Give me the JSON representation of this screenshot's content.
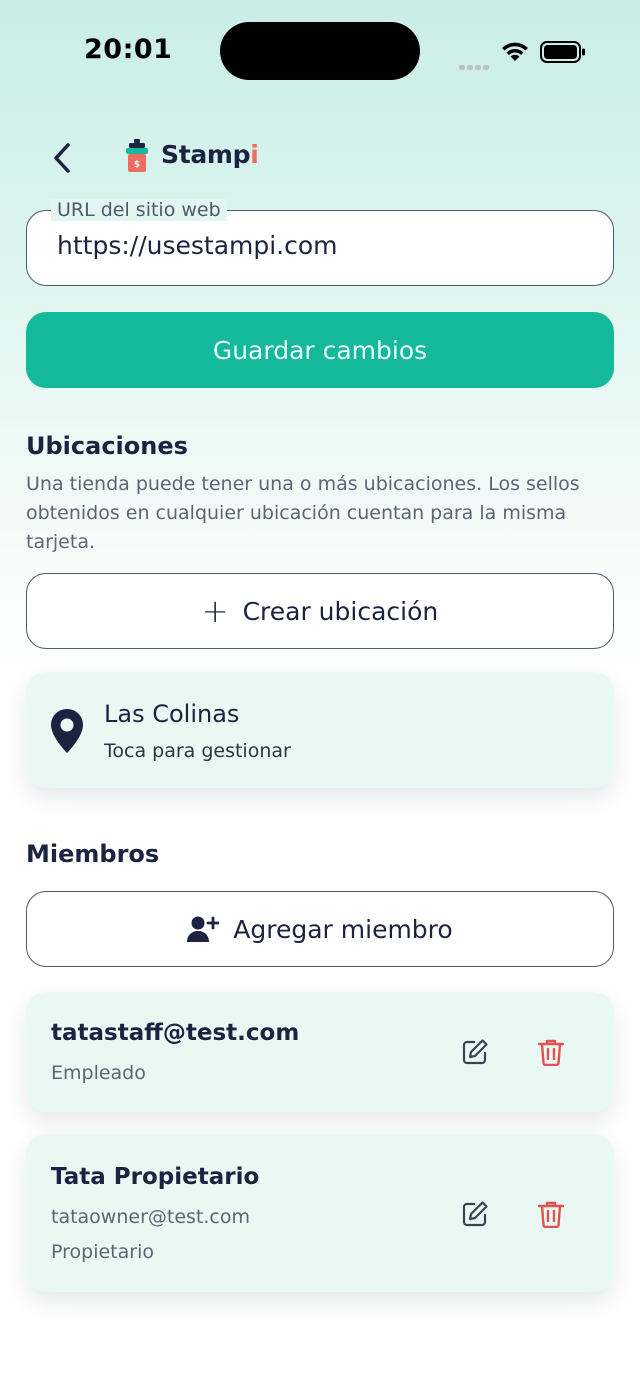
{
  "status_bar": {
    "time": "20:01"
  },
  "header": {
    "logo_text_main": "Stamp",
    "logo_text_accent": "i"
  },
  "website_field": {
    "label": "URL del sitio web",
    "value": "https://usestampi.com"
  },
  "save_button": {
    "label": "Guardar cambios"
  },
  "locations": {
    "title": "Ubicaciones",
    "description": "Una tienda puede tener una o más ubicaciones. Los sellos obtenidos en cualquier ubicación cuentan para la misma tarjeta.",
    "create_button": {
      "icon_text": "+",
      "label": "Crear ubicación"
    },
    "items": [
      {
        "name": "Las Colinas",
        "subtitle": "Toca para gestionar"
      }
    ]
  },
  "members": {
    "title": "Miembros",
    "add_button": {
      "label": "Agregar miembro"
    },
    "items": [
      {
        "name": "tatastaff@test.com",
        "role": "Empleado"
      },
      {
        "name": "Tata Propietario",
        "email": "tataowner@test.com",
        "role": "Propietario"
      }
    ]
  },
  "colors": {
    "primary": "#14b89a",
    "text": "#1c2340",
    "danger": "#e0524f",
    "card_bg": "#eaf8f3",
    "logo_accent": "#ef6b60"
  },
  "icons": [
    "back-chevron-icon",
    "stampi-logo-icon",
    "location-pin-icon",
    "add-user-icon",
    "edit-icon",
    "trash-icon",
    "wifi-icon",
    "battery-icon"
  ]
}
